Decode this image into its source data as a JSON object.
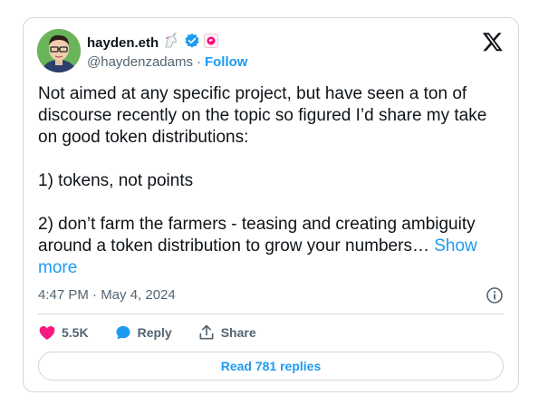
{
  "author": {
    "name": "hayden.eth",
    "handle": "@haydenzadams",
    "separator": "·",
    "follow_label": "Follow"
  },
  "tweet": {
    "text": "Not aimed at any specific project, but have seen a ton of discourse recently on the topic so figured I’d share my take on good token distributions:\n\n1) tokens, not points\n\n2) don’t farm the farmers - teasing and creating ambiguity around a token distribution to grow your numbers… ",
    "show_more_label": "Show more",
    "timestamp": "4:47 PM · May 4, 2024"
  },
  "actions": {
    "likes": "5.5K",
    "reply_label": "Reply",
    "share_label": "Share"
  },
  "replies_button": "Read 781 replies",
  "colors": {
    "accent": "#1d9bf0",
    "like": "#f91880",
    "muted": "#536471",
    "border": "#cfd9de"
  },
  "icons": [
    "unicorn-emoji-icon",
    "verified-badge-icon",
    "uniswap-badge-icon",
    "x-logo-icon",
    "info-icon",
    "heart-icon",
    "reply-bubble-icon",
    "share-icon"
  ]
}
